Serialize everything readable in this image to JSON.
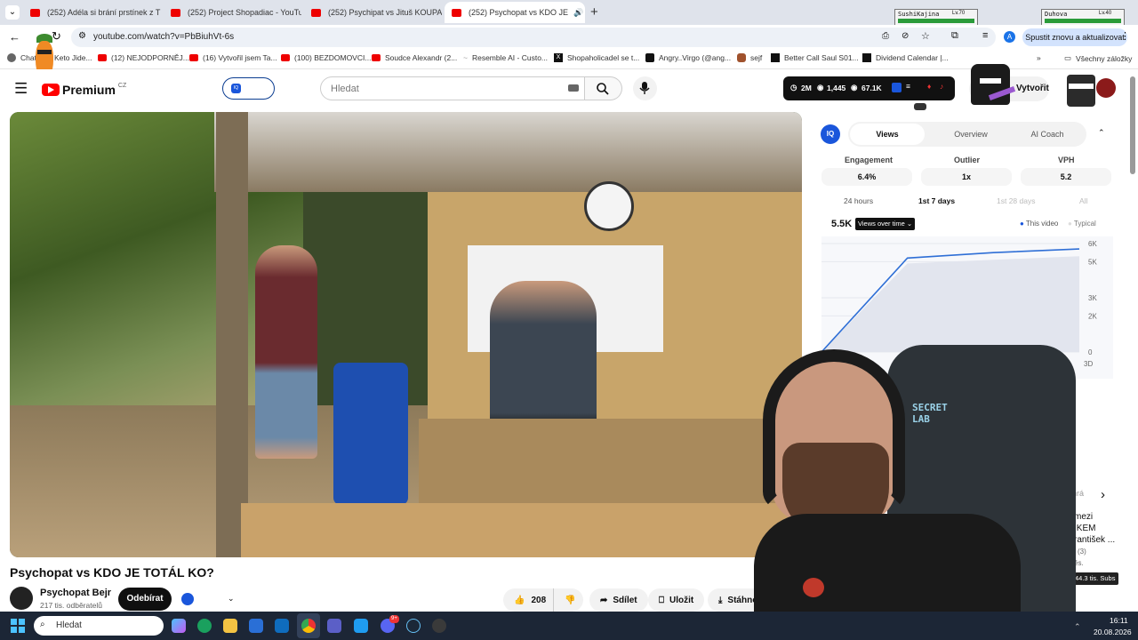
{
  "browser": {
    "tabs": [
      {
        "label": "(252) Adéla si brání prstínek z T"
      },
      {
        "label": "(252) Project Shopadiac - YouTu"
      },
      {
        "label": "(252) Psychipat vs Jituš KOUPAC"
      },
      {
        "label": "(252) Psychopat vs KDO JE",
        "active": true
      }
    ],
    "url": "youtube.com/watch?v=PbBiuhVt-6s",
    "restart_label": "Spustit znovu a aktualizovat",
    "profile_initial": "A",
    "bookmarks": [
      "Chat...",
      "Keto Jide...",
      "(12) NEJODPORNĚJ...",
      "(16) Vytvořil jsem Ta...",
      "(100) BEZDOMOVCI...",
      "Soudce Alexandr (2...",
      "Resemble AI - Custo...",
      "Shopaholicadel se t...",
      "Angry..Virgo (@ang...",
      "sejf",
      "Better Call Saul S01...",
      "Dividend Calendar |..."
    ],
    "all_bookmarks": "Všechny záložky"
  },
  "overlay": {
    "player1": {
      "name": "SushiKajina",
      "level": "Lv.70"
    },
    "player2": {
      "name": "Duhova",
      "level": "Lv.40"
    }
  },
  "youtube": {
    "logo": "Premium",
    "region": "CZ",
    "search_placeholder": "Hledat",
    "stats": {
      "subs": "2M",
      "videos": "1,445",
      "views": "67.1K"
    },
    "create_label": "Vytvořit",
    "video_title": "Psychopat vs KDO JE TOTÁL KO?",
    "channel": {
      "name": "Psychopat Bejr",
      "subscribers": "217 tis. odběratelů",
      "subscribe_label": "Odebírat"
    },
    "actions": {
      "likes": "208",
      "share": "Sdílet",
      "save": "Uložit",
      "download": "Stáhno"
    }
  },
  "analytics": {
    "tabs": [
      "Views",
      "Overview",
      "AI Coach"
    ],
    "metrics": [
      {
        "label": "Engagement",
        "value": "6.4%"
      },
      {
        "label": "Outlier",
        "value": "1x"
      },
      {
        "label": "VPH",
        "value": "5.2"
      }
    ],
    "ranges": [
      "24 hours",
      "1st 7 days",
      "1st 28 days",
      "All"
    ],
    "total": "5.5K",
    "dropdown": "Views over time",
    "legend": {
      "this_video": "This video",
      "typical": "Typical"
    },
    "yticks": [
      "6K",
      "5K",
      "3K",
      "2K",
      "0"
    ],
    "xtick": "3D"
  },
  "chart_data": {
    "type": "line",
    "title": "",
    "xlabel": "",
    "ylabel": "",
    "x": [
      0,
      1,
      2,
      3
    ],
    "series": [
      {
        "name": "This video",
        "values": [
          0,
          5200,
          5500,
          5700
        ]
      },
      {
        "name": "Typical",
        "values": [
          0,
          4900,
          5100,
          5300
        ]
      }
    ],
    "ylim": [
      0,
      6000
    ],
    "yticks": [
      "0",
      "2K",
      "3K",
      "5K",
      "6K"
    ],
    "xticks": [
      "3D"
    ]
  },
  "recommend": {
    "lines": [
      "mezi",
      "IKEM",
      "rantišek ...",
      "l (3)",
      "ěs."
    ],
    "subs_badge": "44.3 tis. Subs",
    "truncated_label": "hrá"
  },
  "taskbar": {
    "search": "Hledat",
    "time": "16:11",
    "date": "20.08.2026",
    "badge": "9+"
  },
  "colors": {
    "accent": "#065fd4",
    "red": "#ff0000",
    "tabbar": "#dfe3eb",
    "taskbar": "#1c2636"
  }
}
